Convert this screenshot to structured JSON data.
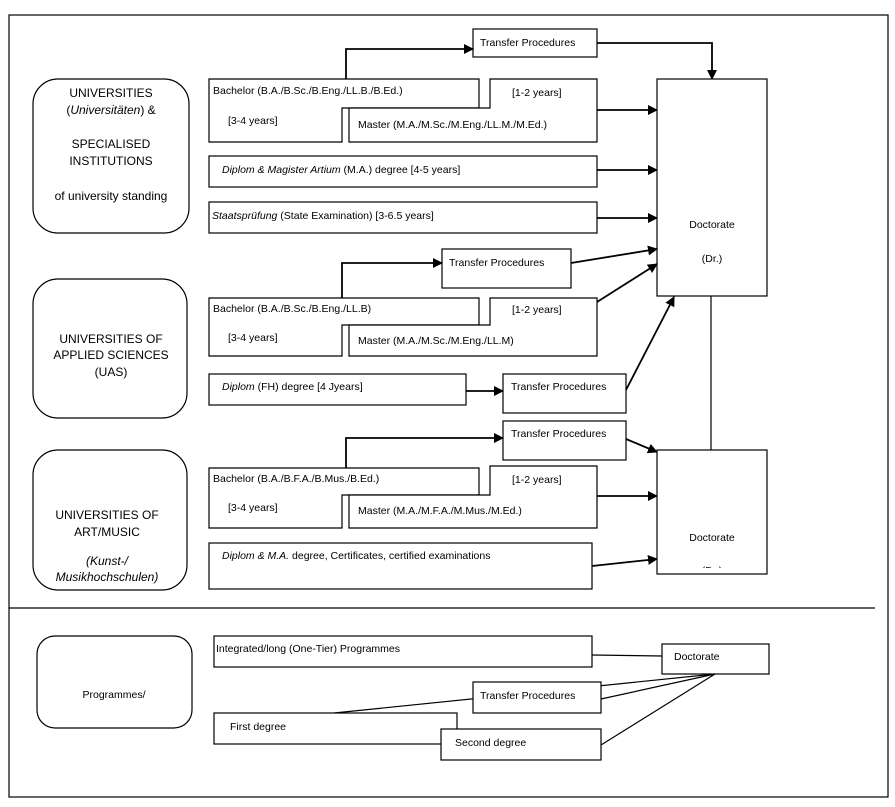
{
  "universities": {
    "institution": [
      "UNIVERSITIES",
      "(Universitäten) &",
      "SPECIALISED",
      "INSTITUTIONS",
      "of university standing"
    ],
    "institution_italic_word": "Universitäten",
    "bachelor": "Bachelor (B.A./B.Sc./B.Eng./LL.B./B.Ed.)",
    "bachelor_years": "[3-4 years]",
    "master_years": "[1-2 years]",
    "master": "Master (M.A./M.Sc./M.Eng./LL.M./M.Ed.)",
    "transfer": "Transfer Procedures",
    "diplom_italic": "Diplom & Magister Artium",
    "diplom_rest": " (M.A.) degree [4-5 years]",
    "staats_italic": "Staatsprüfung",
    "staats_rest": " (State Examination) [3-6.5 years]",
    "doctorate": "Doctorate",
    "doctorate_abbr": "(Dr.)"
  },
  "uas": {
    "institution": [
      "UNIVERSITIES OF",
      "APPLIED SCIENCES",
      "(UAS)"
    ],
    "transfer": "Transfer Procedures",
    "bachelor": "Bachelor (B.A./B.Sc./B.Eng./LL.B)",
    "bachelor_years": "[3-4 years]",
    "master_years": "[1-2 years]",
    "master": "Master (M.A./M.Sc./M.Eng./LL.M)",
    "diplom_italic": "Diplom",
    "diplom_rest": " (FH) degree [4 Jyears]",
    "transfer_diplom": "Transfer Procedures"
  },
  "art": {
    "institution": [
      "UNIVERSITIES OF",
      "ART/MUSIC",
      "(Kunst-/",
      "Musikhochschulen)"
    ],
    "transfer": "Transfer Procedures",
    "bachelor": "Bachelor (B.A./B.F.A./B.Mus./B.Ed.)",
    "bachelor_years": "[3-4 years]",
    "master_years": "[1-2 years]",
    "master": "Master (M.A./M.F.A./M.Mus./M.Ed.)",
    "diplom_italic": "Diplom & M.A.",
    "diplom_rest": " degree, Certificates, certified examinations",
    "doctorate": "Doctorate",
    "doctorate_abbr": "(Dr.)"
  },
  "legend": {
    "programmes": "Programmes/",
    "integrated": "Integrated/long (One-Tier) Programmes",
    "doctorate": "Doctorate",
    "transfer": "Transfer Procedures",
    "first_degree": "First degree",
    "second_degree": "Second degree"
  }
}
